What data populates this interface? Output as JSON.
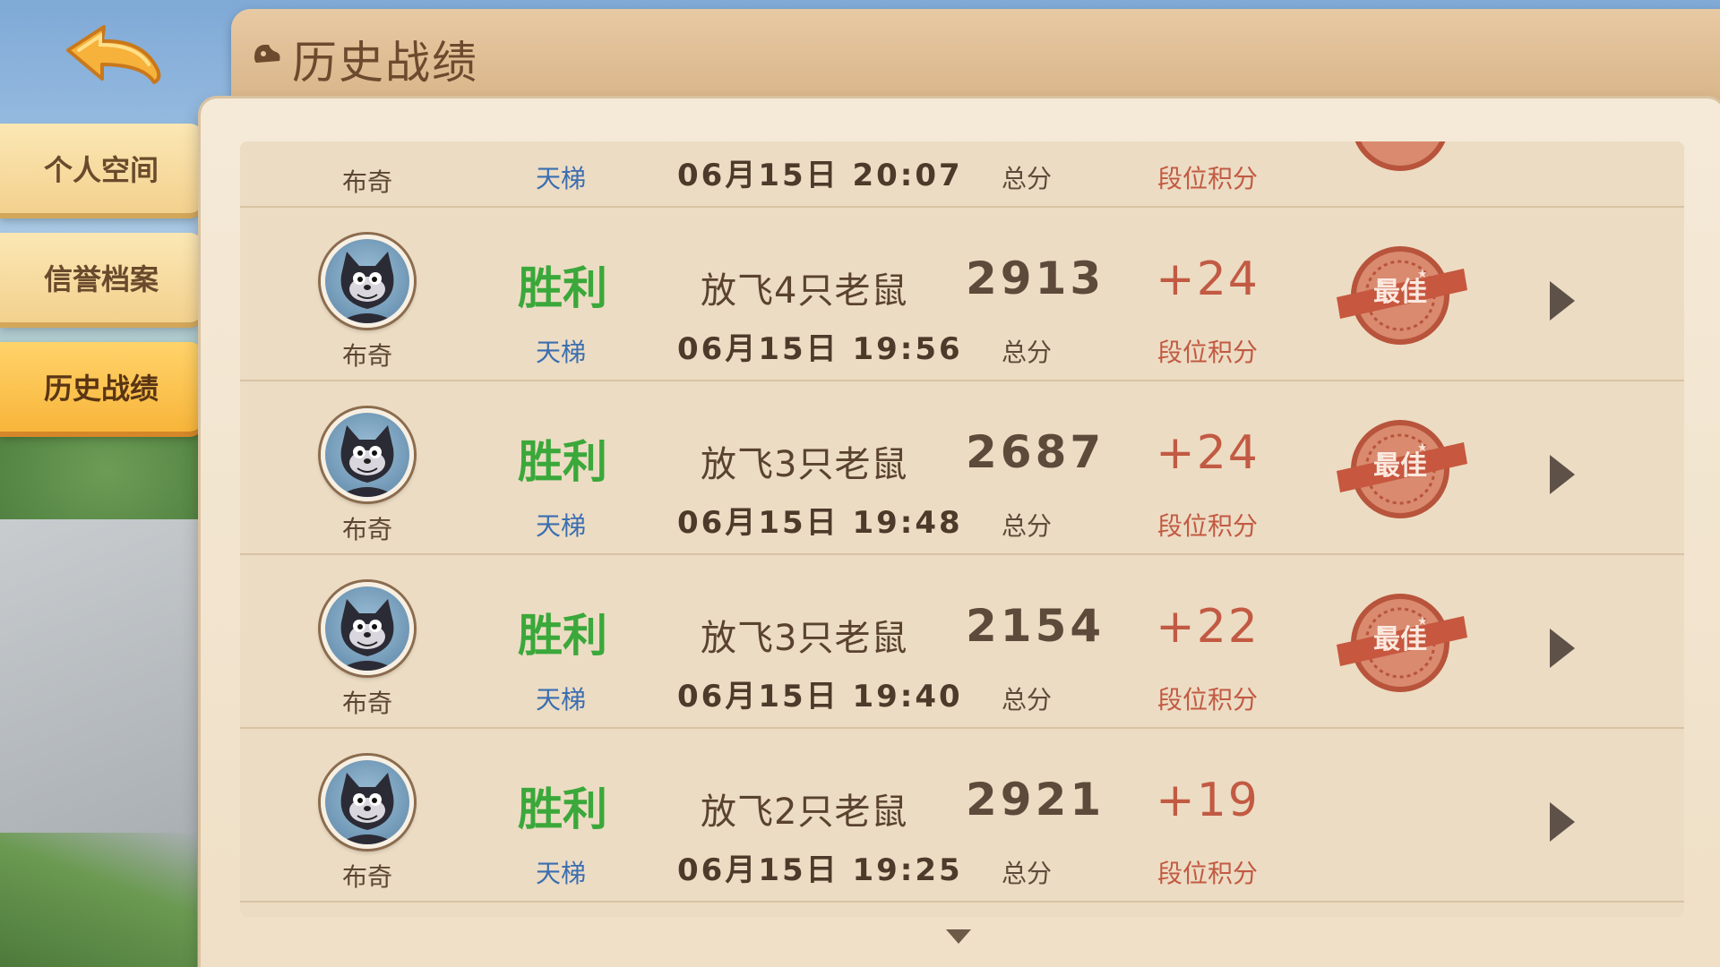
{
  "header": {
    "title": "历史战绩"
  },
  "nav": {
    "items": [
      {
        "label": "个人空间",
        "active": false
      },
      {
        "label": "信誉档案",
        "active": false
      },
      {
        "label": "历史战绩",
        "active": true
      }
    ]
  },
  "partial_row_top": {
    "player": "布奇",
    "mode": "天梯",
    "time": "06月15日 20:07",
    "score_label": "总分",
    "rank_label": "段位积分"
  },
  "matches": [
    {
      "player": "布奇",
      "result": "胜利",
      "mode": "天梯",
      "desc": "放飞4只老鼠",
      "time": "06月15日 19:56",
      "score": "2913",
      "score_label": "总分",
      "rank_delta": "+24",
      "rank_label": "段位积分",
      "best": true,
      "badge_text": "最佳"
    },
    {
      "player": "布奇",
      "result": "胜利",
      "mode": "天梯",
      "desc": "放飞3只老鼠",
      "time": "06月15日 19:48",
      "score": "2687",
      "score_label": "总分",
      "rank_delta": "+24",
      "rank_label": "段位积分",
      "best": true,
      "badge_text": "最佳"
    },
    {
      "player": "布奇",
      "result": "胜利",
      "mode": "天梯",
      "desc": "放飞3只老鼠",
      "time": "06月15日 19:40",
      "score": "2154",
      "score_label": "总分",
      "rank_delta": "+22",
      "rank_label": "段位积分",
      "best": true,
      "badge_text": "最佳"
    },
    {
      "player": "布奇",
      "result": "胜利",
      "mode": "天梯",
      "desc": "放飞2只老鼠",
      "time": "06月15日 19:25",
      "score": "2921",
      "score_label": "总分",
      "rank_delta": "+19",
      "rank_label": "段位积分",
      "best": false,
      "badge_text": ""
    }
  ],
  "colors": {
    "victory": "#3aa83a",
    "mode": "#3b6eb0",
    "rank_points": "#c25a43",
    "active_tab": "#f8b53a"
  },
  "icons": {
    "back": "back-arrow-icon",
    "title": "shoe-icon",
    "best_badge": "best-seal-icon",
    "row_detail": "play-arrow-icon",
    "scroll": "triangle-down-icon"
  }
}
